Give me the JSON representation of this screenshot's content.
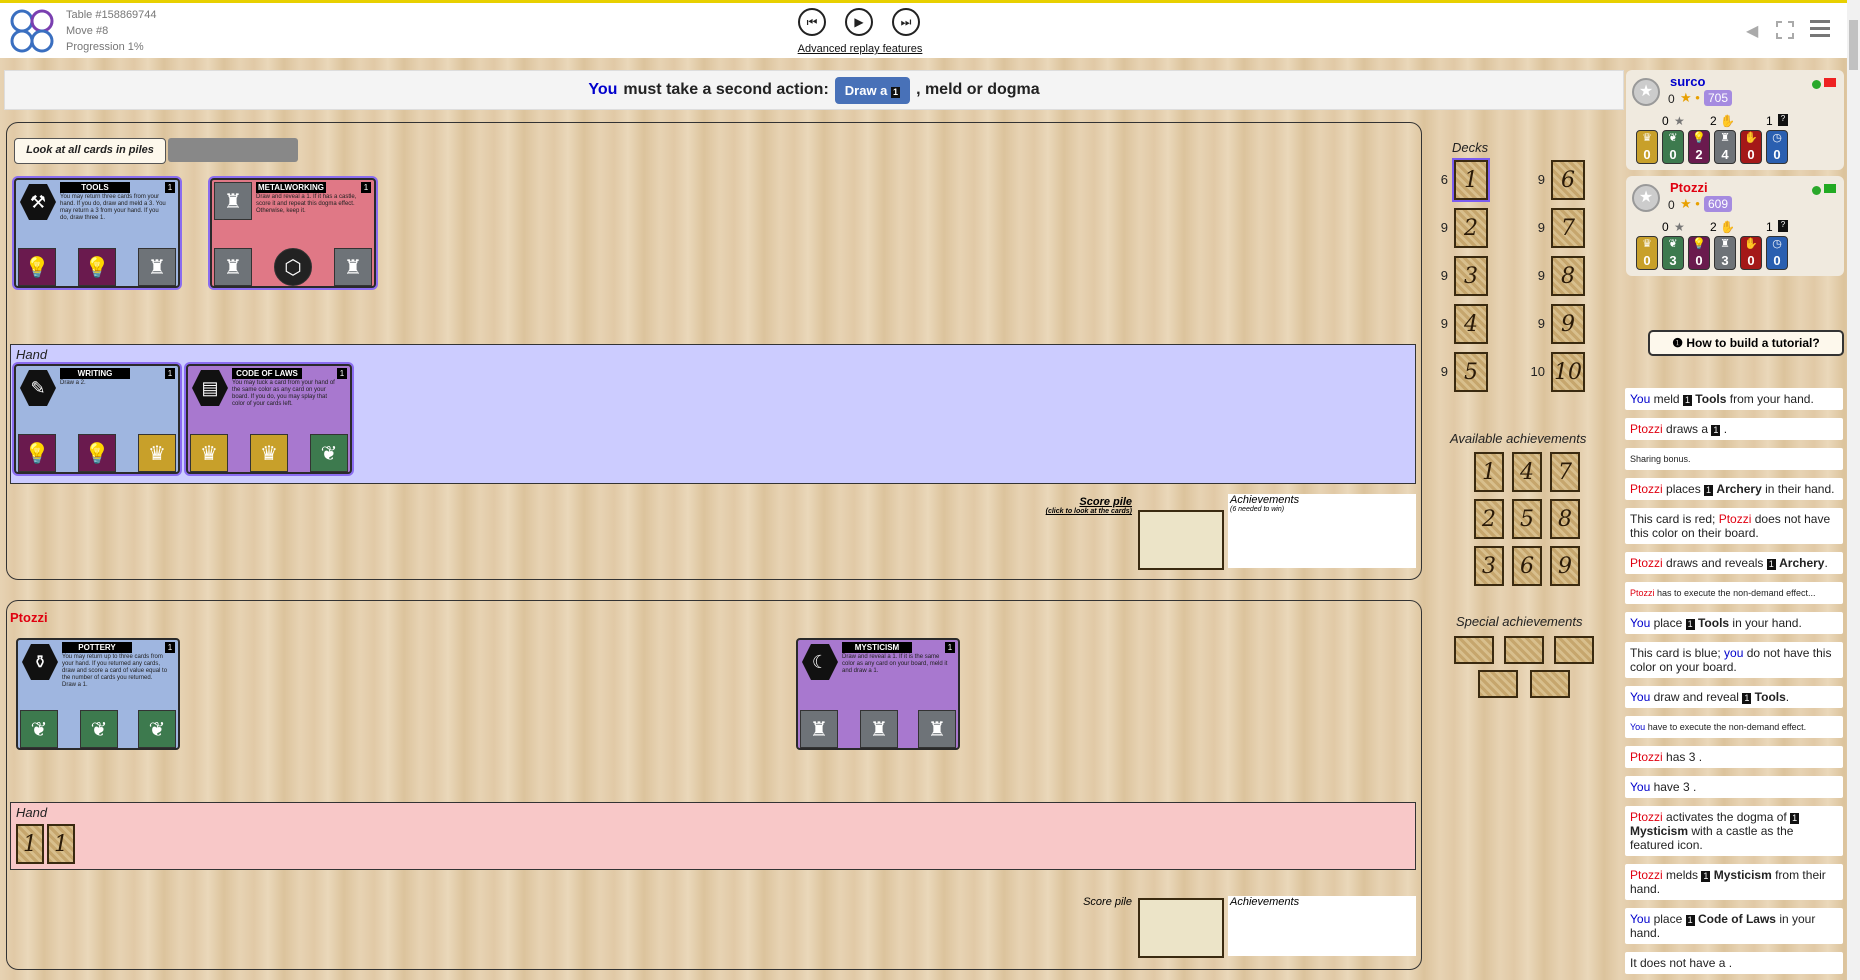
{
  "topbar": {
    "table": "Table #158869744",
    "move": "Move #8",
    "progression": "Progression 1%",
    "advanced_replay": "Advanced replay features"
  },
  "action": {
    "you": "You",
    "prefix": "must take a second action:",
    "draw_button": "Draw a",
    "draw_age": "1",
    "suffix": ", meld or dogma"
  },
  "my_area": {
    "look_button": "Look at all cards in piles",
    "hand_label": "Hand",
    "score_pile_label": "Score pile",
    "score_pile_hint": "(click to look at the cards)",
    "achievements_label": "Achievements",
    "achievements_hint": "(6 needed to win)",
    "board": [
      {
        "title": "TOOLS",
        "age": "1",
        "color": "blue",
        "text": "You may return three cards from your hand. If you do, draw and meld a 3. You may return a 3 from your hand. If you do, draw three 1."
      },
      {
        "title": "METALWORKING",
        "age": "1",
        "color": "red",
        "text": "Draw and reveal a 1. If it has a castle, score it and repeat this dogma effect. Otherwise, keep it."
      }
    ],
    "hand": [
      {
        "title": "WRITING",
        "age": "1",
        "color": "blue",
        "text": "Draw a 2."
      },
      {
        "title": "CODE OF LAWS",
        "age": "1",
        "color": "purple",
        "text": "You may tuck a card from your hand of the same color as any card on your board. If you do, you may splay that color of your cards left."
      }
    ]
  },
  "opponent_area": {
    "name": "Ptozzi",
    "hand_label": "Hand",
    "score_pile_label": "Score pile",
    "achievements_label": "Achievements",
    "hand_cards": [
      "1",
      "1"
    ],
    "board": [
      {
        "title": "POTTERY",
        "age": "1",
        "color": "blue",
        "text": "You may return up to three cards from your hand. If you returned any cards, draw and score a card of value equal to the number of cards you returned. Draw a 1."
      },
      {
        "title": "MYSTICISM",
        "age": "1",
        "color": "purple",
        "text": "Draw and reveal a 1. If it is the same color as any card on your board, meld it and draw a 1."
      }
    ]
  },
  "decks": {
    "label": "Decks",
    "items": [
      {
        "age": "1",
        "count": "6"
      },
      {
        "age": "6",
        "count": "9"
      },
      {
        "age": "2",
        "count": "9"
      },
      {
        "age": "7",
        "count": "9"
      },
      {
        "age": "3",
        "count": "9"
      },
      {
        "age": "8",
        "count": "9"
      },
      {
        "age": "4",
        "count": "9"
      },
      {
        "age": "9",
        "count": "9"
      },
      {
        "age": "5",
        "count": "9"
      },
      {
        "age": "10",
        "count": "10"
      }
    ]
  },
  "available_achievements": {
    "label": "Available achievements",
    "items": [
      "1",
      "4",
      "7",
      "2",
      "5",
      "8",
      "3",
      "6",
      "9"
    ]
  },
  "special_achievements": {
    "label": "Special achievements"
  },
  "players": [
    {
      "name": "surco",
      "name_color": "#0000cc",
      "stars": "0",
      "elo": "705",
      "achv": "0",
      "score": "2",
      "hand": "1",
      "resources": [
        "0",
        "0",
        "2",
        "4",
        "0",
        "0"
      ]
    },
    {
      "name": "Ptozzi",
      "name_color": "#e00010",
      "stars": "0",
      "elo": "609",
      "achv": "0",
      "score": "2",
      "hand": "1",
      "resources": [
        "0",
        "3",
        "0",
        "3",
        "0",
        "0"
      ]
    }
  ],
  "tutorial_button": "How to build a tutorial?",
  "log": [
    {
      "actor": "You",
      "actor_color": "blu",
      "text": " meld ",
      "age": "1",
      "bold": "Tools",
      "rest": " from your hand."
    },
    {
      "actor": "Ptozzi",
      "actor_color": "red",
      "text": " draws a ",
      "age": "1",
      "bold": "",
      "rest": "."
    },
    {
      "actor": "",
      "actor_color": "",
      "text": "Sharing bonus.",
      "age": "",
      "bold": "",
      "rest": "",
      "small": true
    },
    {
      "actor": "Ptozzi",
      "actor_color": "red",
      "text": " places ",
      "age": "1",
      "bold": "Archery",
      "rest": " in their hand."
    },
    {
      "actor": "",
      "actor_color": "",
      "text": "This card is red; ",
      "age": "",
      "bold": "",
      "rest": "",
      "tail_actor": "Ptozzi",
      "tail_color": "red",
      "tail_text": " does not have this color on their board."
    },
    {
      "actor": "Ptozzi",
      "actor_color": "red",
      "text": " draws and reveals ",
      "age": "1",
      "bold": "Archery",
      "rest": "."
    },
    {
      "actor": "Ptozzi",
      "actor_color": "red",
      "text": " has to execute the non-demand effect...",
      "age": "",
      "bold": "",
      "rest": "",
      "small": true
    },
    {
      "actor": "You",
      "actor_color": "blu",
      "text": " place ",
      "age": "1",
      "bold": "Tools",
      "rest": " in your hand."
    },
    {
      "actor": "",
      "actor_color": "",
      "text": "This card is blue; ",
      "age": "",
      "bold": "",
      "rest": "",
      "tail_actor": "you",
      "tail_color": "blu",
      "tail_text": " do not have this color on your board."
    },
    {
      "actor": "You",
      "actor_color": "blu",
      "text": " draw and reveal ",
      "age": "1",
      "bold": "Tools",
      "rest": "."
    },
    {
      "actor": "You",
      "actor_color": "blu",
      "text": " have to execute the non-demand effect.",
      "age": "",
      "bold": "",
      "rest": "",
      "small": true
    },
    {
      "actor": "Ptozzi",
      "actor_color": "red",
      "text": " has 3 ",
      "age": "",
      "bold": "",
      "rest": "."
    },
    {
      "actor": "You",
      "actor_color": "blu",
      "text": " have 3 ",
      "age": "",
      "bold": "",
      "rest": "."
    },
    {
      "actor": "Ptozzi",
      "actor_color": "red",
      "text": " activates the dogma of ",
      "age": "1",
      "bold": "Mysticism",
      "rest": " with a castle as the featured icon."
    },
    {
      "actor": "Ptozzi",
      "actor_color": "red",
      "text": " melds ",
      "age": "1",
      "bold": "Mysticism",
      "rest": " from their hand."
    },
    {
      "actor": "You",
      "actor_color": "blu",
      "text": " place ",
      "age": "1",
      "bold": "Code of Laws",
      "rest": " in your hand."
    },
    {
      "actor": "",
      "actor_color": "",
      "text": "It does not have a ",
      "age": "",
      "bold": "",
      "rest": "."
    }
  ],
  "colors": {
    "accent_button": "#4871b8",
    "you": "#0000cc",
    "opponent": "#e00010",
    "my_hand_zone": "#ccccff",
    "opp_hand_zone": "#f8c8c8"
  }
}
